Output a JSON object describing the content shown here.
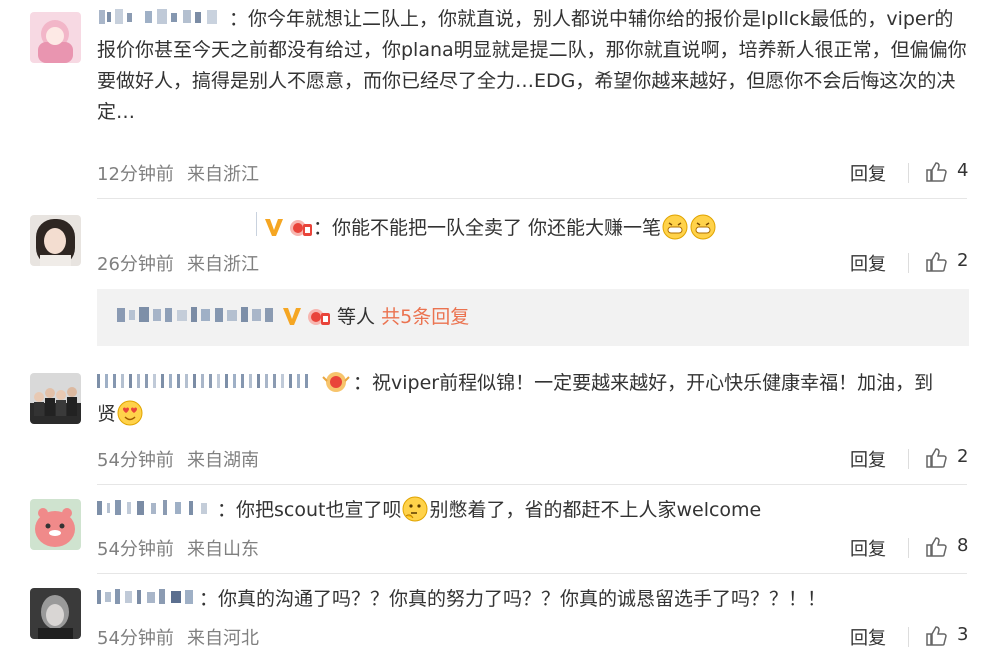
{
  "comments": [
    {
      "text": "：你今年就想让二队上，你就直说，别人都说中辅你给的报价是lpllck最低的，viper的报价你甚至今天之前都没有给过，你plana明显就是提二队，那你就直说啊，培养新人很正常，但偏偏你要做好人，搞得是别人不愿意，而你已经尽了全力…EDG，希望你越来越好，但愿你不会后悔这次的决定…",
      "time": "12分钟前",
      "location": "来自浙江",
      "reply_label": "回复",
      "likes": "4"
    },
    {
      "text": "：你能不能把一队全卖了 你还能大赚一笔",
      "time": "26分钟前",
      "location": "来自浙江",
      "reply_label": "回复",
      "likes": "2"
    },
    {
      "text_a": "：祝viper前程似锦！一定要越来越好，开心快乐健康幸福！加油，到",
      "text_b": "贤",
      "time": "54分钟前",
      "location": "来自湖南",
      "reply_label": "回复",
      "likes": "2"
    },
    {
      "text_a": "：你把scout也宣了呗",
      "text_b": "别憋着了，省的都赶不上人家welcome",
      "time": "54分钟前",
      "location": "来自山东",
      "reply_label": "回复",
      "likes": "8"
    },
    {
      "text": "：你真的沟通了吗？？你真的努力了吗？？你真的诚恳留选手了吗？？！！",
      "time": "54分钟前",
      "location": "来自河北",
      "reply_label": "回复",
      "likes": "3"
    }
  ],
  "sub_replies": {
    "suffix": "等人",
    "link": "共5条回复"
  },
  "icons": {
    "like": "thumbs-up-icon",
    "verified": "verified-v-icon",
    "fan_badge": "fan-badge-icon"
  },
  "colors": {
    "link": "#eb7350",
    "meta": "#808080",
    "verified": "#f5a623"
  }
}
